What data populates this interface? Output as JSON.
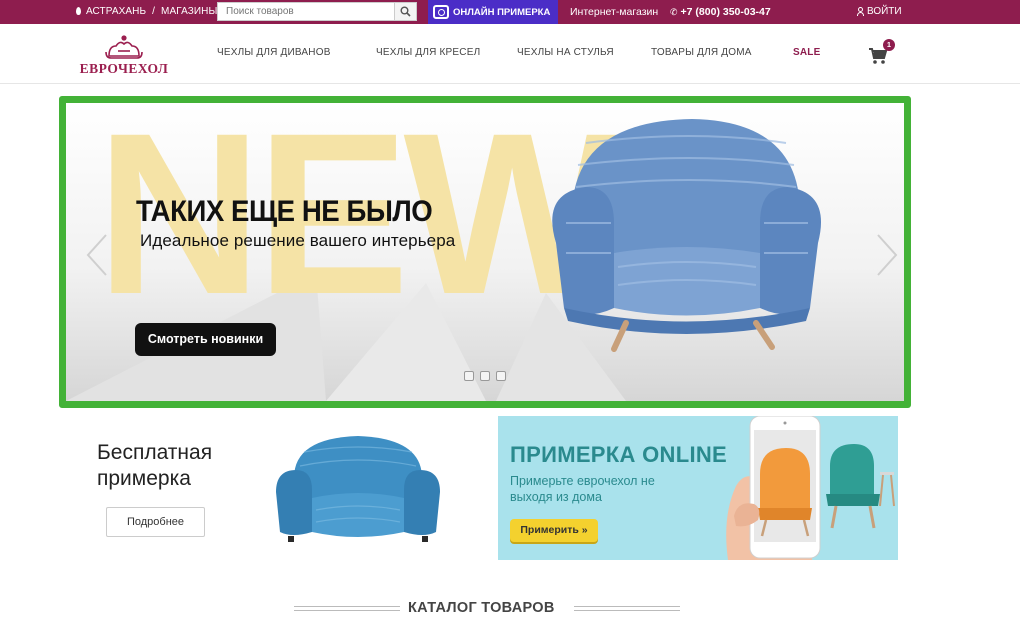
{
  "topbar": {
    "city": "АСТРАХАНЬ",
    "separator": "/",
    "stores": "МАГАЗИНЫ",
    "search_placeholder": "Поиск товаров",
    "online_fitting": "ОНЛАЙН ПРИМЕРКА",
    "shop_label": "Интернет-магазин",
    "phone": "+7 (800) 350-03-47",
    "login": "ВОЙТИ"
  },
  "header": {
    "logo_text": "ЕВРОЧЕХОЛ",
    "nav": [
      {
        "label": "ЧЕХЛЫ ДЛЯ ДИВАНОВ"
      },
      {
        "label": "ЧЕХЛЫ ДЛЯ КРЕСЕЛ"
      },
      {
        "label": "ЧЕХЛЫ НА СТУЛЬЯ"
      },
      {
        "label": "ТОВАРЫ ДЛЯ ДОМА"
      },
      {
        "label": "SALE"
      }
    ],
    "cart_count": "1"
  },
  "hero": {
    "bg_word": "NEW",
    "title": "ТАКИХ ЕЩЕ НЕ БЫЛО",
    "subtitle": "Идеальное решение вашего интерьера",
    "cta": "Смотреть новинки",
    "slides": 3,
    "frame_color": "#43b237"
  },
  "promo_left": {
    "title": "Бесплатная примерка",
    "button": "Подробнее"
  },
  "promo_right": {
    "title": "ПРИМЕРКА ONLINE",
    "subtitle": "Примерьте еврочехол не выходя из дома",
    "button": "Примерить »"
  },
  "catalog": {
    "title": "КАТАЛОГ ТОВАРОВ"
  },
  "colors": {
    "brand": "#8e1d4e",
    "online_button": "#4b2dc7",
    "accent_yellow": "#f4d12e",
    "promo_bg": "#a9e2ec"
  }
}
